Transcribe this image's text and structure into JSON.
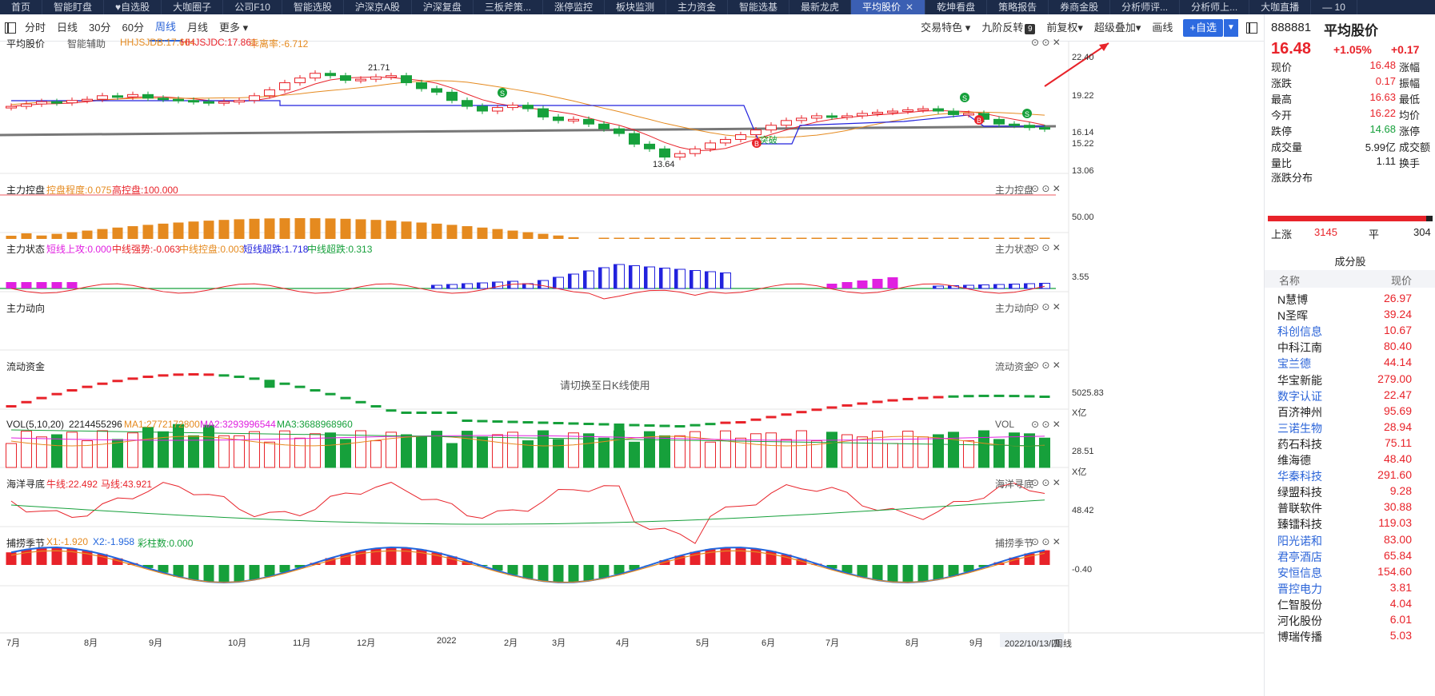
{
  "topnav": {
    "tabs": [
      {
        "label": "首页",
        "active": false
      },
      {
        "label": "智能盯盘",
        "active": false
      },
      {
        "label": "♥自选股",
        "active": false
      },
      {
        "label": "大咖圈子",
        "active": false
      },
      {
        "label": "公司F10",
        "active": false
      },
      {
        "label": "智能选股",
        "active": false
      },
      {
        "label": "沪深京A股",
        "active": false
      },
      {
        "label": "沪深复盘",
        "active": false
      },
      {
        "label": "三板斧策...",
        "active": false
      },
      {
        "label": "涨停监控",
        "active": false
      },
      {
        "label": "板块监测",
        "active": false
      },
      {
        "label": "主力资金",
        "active": false
      },
      {
        "label": "智能选基",
        "active": false
      },
      {
        "label": "最新龙虎",
        "active": false
      },
      {
        "label": "平均股价",
        "active": true,
        "close": "✕"
      },
      {
        "label": "乾坤看盘",
        "active": false
      },
      {
        "label": "策略报告",
        "active": false
      },
      {
        "label": "券商金股",
        "active": false
      },
      {
        "label": "分析师评...",
        "active": false
      },
      {
        "label": "分析师上...",
        "active": false
      },
      {
        "label": "大咖直播",
        "active": false
      },
      {
        "label": "—  10",
        "active": false
      }
    ]
  },
  "toolbar": {
    "periods": [
      "分时",
      "日线",
      "30分",
      "60分",
      "周线",
      "月线",
      "更多 ▾"
    ],
    "active_period": "周线",
    "right_items": [
      "交易特色 ▾",
      "九阶反转",
      "前复权▾",
      "超级叠加▾",
      "画线"
    ],
    "badge": "9",
    "add_label": "+自选",
    "add_drop": "▼"
  },
  "panels": {
    "main": {
      "title": "平均股价",
      "sub": "智能辅助",
      "ind1": "HHJSJDB:17.664",
      "ind2": "HHJSJDC:17.861",
      "ind3": "乖离率:-6.712"
    },
    "control": {
      "title": "主力控盘",
      "a": "控盘程度:0.075",
      "b": "高控盘:100.000",
      "tag": "主力控盘"
    },
    "state": {
      "title": "主力状态",
      "a": "短线上攻:0.000",
      "b": "中线强势:-0.063",
      "c": "中线控盘:0.003",
      "d": "短线超跌:1.718",
      "e": "中线超跌:0.313",
      "tag": "主力状态"
    },
    "trend": {
      "title": "主力动向",
      "tag": "主力动向",
      "msg": "请切换至日K线使用"
    },
    "flow": {
      "title": "流动资金",
      "tag": "流动资金"
    },
    "vol": {
      "title": "VOL(5,10,20)",
      "v": "2214455296",
      "ma1": "MA1:2772172800",
      "ma2": "MA2:3293996544",
      "ma3": "MA3:3688968960",
      "tag": "VOL"
    },
    "ocean": {
      "title": "海洋寻底",
      "a": "牛线:22.492",
      "b": "马线:43.921",
      "tag": "海洋寻底"
    },
    "season": {
      "title": "捕捞季节",
      "a": "X1:-1.920",
      "b": "X2:-1.958",
      "c": "彩柱数:0.000",
      "tag": "捕捞季节"
    }
  },
  "axis": {
    "main": [
      "22.40",
      "19.22",
      "16.14",
      "15.22",
      "13.06"
    ],
    "control": [
      "50.00"
    ],
    "state": [
      "3.55"
    ],
    "flow": [
      "5025.83",
      "X亿"
    ],
    "vol": [
      "28.51",
      "X亿"
    ],
    "ocean": [
      "48.42"
    ],
    "season": [
      "-0.40"
    ]
  },
  "annotations": {
    "high": "21.71",
    "low": "13.64",
    "breakout": "突破",
    "sell": "S",
    "buy": "B"
  },
  "months": [
    "7月",
    "8月",
    "9月",
    "10月",
    "11月",
    "12月",
    "2022",
    "2月",
    "3月",
    "4月",
    "5月",
    "6月",
    "7月",
    "8月",
    "9月"
  ],
  "date_label": "2022/10/13/四",
  "period_label": "周线",
  "ctrl_icons": "⊙ ⊙ ✕",
  "quote": {
    "code": "888881",
    "name": "平均股价",
    "price": "16.48",
    "pct": "+1.05%",
    "chg": "+0.17",
    "rows": [
      {
        "k": "现价",
        "v": "16.48",
        "k2": "涨幅",
        "color": "#e8232a"
      },
      {
        "k": "涨跌",
        "v": "0.17",
        "k2": "振幅",
        "color": "#e8232a"
      },
      {
        "k": "最高",
        "v": "16.63",
        "k2": "最低",
        "color": "#e8232a"
      },
      {
        "k": "今开",
        "v": "16.22",
        "k2": "均价",
        "color": "#e8232a"
      },
      {
        "k": "跌停",
        "v": "14.68",
        "k2": "涨停",
        "color": "#16a03b"
      },
      {
        "k": "成交量",
        "v": "5.99亿",
        "k2": "成交额",
        "color": "#222"
      },
      {
        "k": "量比",
        "v": "1.11",
        "k2": "换手",
        "color": "#222"
      }
    ],
    "dist_title": "涨跌分布",
    "up_label": "上涨",
    "up_count": "3145",
    "flat_label": "平",
    "flat_count": "304"
  },
  "constituents": {
    "title": "成分股",
    "head_name": "名称",
    "head_price": "现价",
    "rows": [
      {
        "n": "N慧博",
        "p": "26.97",
        "link": false
      },
      {
        "n": "N圣晖",
        "p": "39.24",
        "link": false
      },
      {
        "n": "科创信息",
        "p": "10.67",
        "link": true
      },
      {
        "n": "中科江南",
        "p": "80.40",
        "link": false
      },
      {
        "n": "宝兰德",
        "p": "44.14",
        "link": true
      },
      {
        "n": "华宝新能",
        "p": "279.00",
        "link": false
      },
      {
        "n": "数字认证",
        "p": "22.47",
        "link": true
      },
      {
        "n": "百济神州",
        "p": "95.69",
        "link": false
      },
      {
        "n": "三诺生物",
        "p": "28.94",
        "link": true
      },
      {
        "n": "药石科技",
        "p": "75.11",
        "link": false
      },
      {
        "n": "维海德",
        "p": "48.40",
        "link": false
      },
      {
        "n": "华秦科技",
        "p": "291.60",
        "link": true
      },
      {
        "n": "绿盟科技",
        "p": "9.28",
        "link": false
      },
      {
        "n": "普联软件",
        "p": "30.88",
        "link": false
      },
      {
        "n": "臻镭科技",
        "p": "119.03",
        "link": false
      },
      {
        "n": "阳光诺和",
        "p": "83.00",
        "link": true
      },
      {
        "n": "君亭酒店",
        "p": "65.84",
        "link": true
      },
      {
        "n": "安恒信息",
        "p": "154.60",
        "link": true
      },
      {
        "n": "晋控电力",
        "p": "3.81",
        "link": true
      },
      {
        "n": "仁智股份",
        "p": "4.04",
        "link": false
      },
      {
        "n": "河化股份",
        "p": "6.01",
        "link": false
      },
      {
        "n": "博瑞传播",
        "p": "5.03",
        "link": false
      }
    ]
  },
  "colors": {
    "up": "#e8232a",
    "down": "#16a03b",
    "accent": "#2d6ae0",
    "nav": "#1c2b49"
  },
  "chart_data": {
    "type": "candlestick",
    "weekly_close": [
      18.4,
      18.6,
      18.8,
      18.7,
      18.9,
      19.0,
      19.3,
      19.2,
      19.4,
      19.1,
      19.0,
      18.9,
      18.8,
      18.7,
      18.8,
      18.9,
      19.3,
      19.8,
      20.4,
      20.8,
      21.2,
      21.0,
      20.6,
      20.7,
      20.9,
      21.0,
      20.4,
      19.9,
      19.6,
      18.9,
      18.4,
      18.0,
      18.3,
      18.5,
      18.2,
      17.5,
      17.2,
      17.3,
      16.9,
      16.5,
      16.1,
      15.2,
      14.8,
      14.1,
      14.4,
      14.8,
      15.3,
      15.6,
      16.0,
      16.4,
      16.8,
      17.2,
      17.4,
      17.6,
      17.5,
      17.6,
      17.8,
      17.9,
      18.0,
      18.1,
      18.2,
      18.0,
      17.7,
      17.8,
      17.3,
      16.9,
      16.8,
      16.6,
      16.48
    ],
    "months": [
      "7月",
      "8月",
      "9月",
      "10月",
      "11月",
      "12月",
      "2022",
      "2月",
      "3月",
      "4月",
      "5月",
      "6月",
      "7月",
      "8月",
      "9月"
    ]
  }
}
